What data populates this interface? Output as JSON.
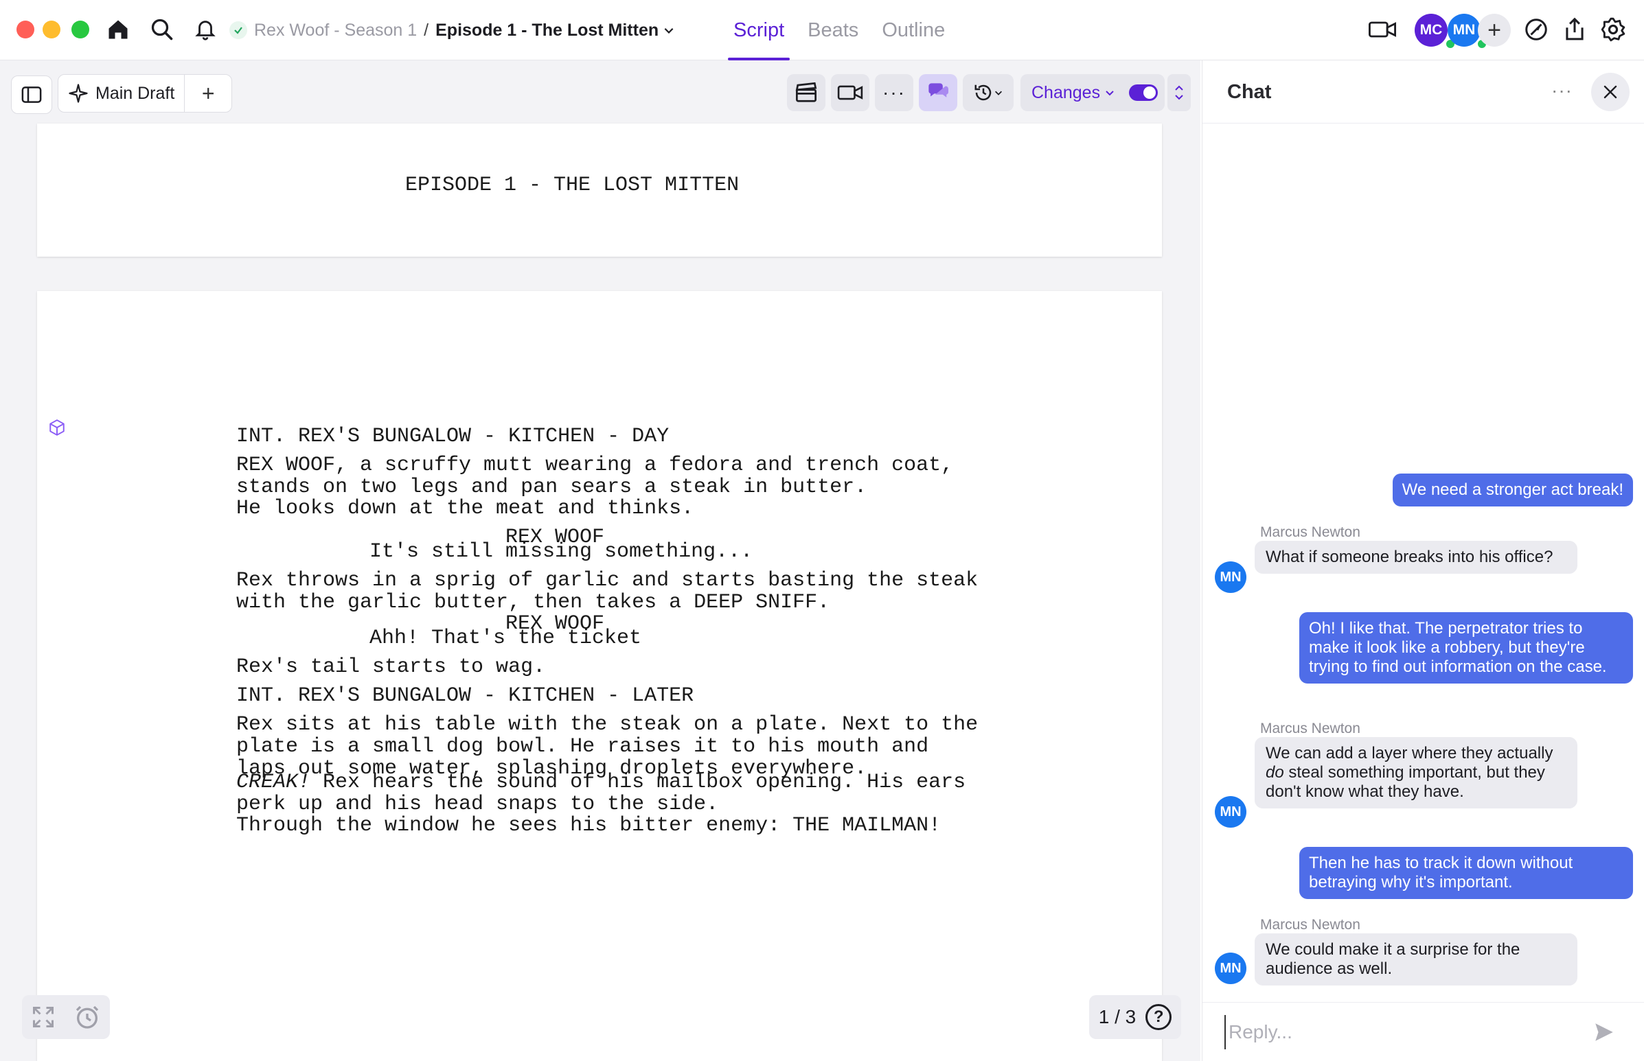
{
  "breadcrumb": {
    "season": "Rex Woof - Season 1",
    "separator": "/",
    "episode": "Episode 1 - The Lost Mitten"
  },
  "tabs": [
    "Script",
    "Beats",
    "Outline"
  ],
  "active_tab": "Script",
  "collaborators": [
    "MC",
    "MN"
  ],
  "toolbar": {
    "draft_label": "Main Draft",
    "changes_label": "Changes",
    "changes_enabled": true
  },
  "script": {
    "page_title": "EPISODE 1 - THE LOST MITTEN",
    "lines": [
      {
        "type": "scene",
        "text": "INT. REX'S BUNGALOW - KITCHEN - DAY"
      },
      {
        "type": "action",
        "text": "REX WOOF, a scruffy mutt wearing a fedora and trench coat,\nstands on two legs and pan sears a steak in butter."
      },
      {
        "type": "action",
        "text": "He looks down at the meat and thinks."
      },
      {
        "type": "character",
        "text": "REX WOOF"
      },
      {
        "type": "dialogue",
        "text": "It's still missing something..."
      },
      {
        "type": "action",
        "text": "Rex throws in a sprig of garlic and starts basting the steak\nwith the garlic butter, then takes a DEEP SNIFF."
      },
      {
        "type": "character",
        "text": "REX WOOF"
      },
      {
        "type": "dialogue",
        "text": "Ahh! That's the ticket"
      },
      {
        "type": "action",
        "text": "Rex's tail starts to wag."
      },
      {
        "type": "scene",
        "text": "INT. REX'S BUNGALOW - KITCHEN - LATER"
      },
      {
        "type": "action",
        "text": "Rex sits at his table with the steak on a plate. Next to the\nplate is a small dog bowl. He raises it to his mouth and\nlaps out some water, splashing droplets everywhere."
      },
      {
        "type": "action-italic",
        "emph": "CREAK!",
        "text": " Rex hears the sound of his mailbox opening. His ears\nperk up and his head snaps to the side."
      },
      {
        "type": "action",
        "text": "Through the window he sees his bitter enemy: THE MAILMAN!"
      }
    ]
  },
  "pager": {
    "text": "1 / 3",
    "help": "?"
  },
  "chat": {
    "title": "Chat",
    "more": "···",
    "messages": [
      {
        "from": "me",
        "text": "We need a stronger act break!"
      },
      {
        "from": "Marcus Newton",
        "initials": "MN",
        "text": "What if someone breaks into his office?"
      },
      {
        "from": "me",
        "text": "Oh! I like that. The perpetrator tries to make it look like a robbery, but they're trying to find out information on the case."
      },
      {
        "from": "Marcus Newton",
        "initials": "MN",
        "text_before": "We can add a layer where they actually ",
        "text_emph": "do",
        "text_after": " steal something important, but they don't know what they have."
      },
      {
        "from": "me",
        "text": "Then he has to track it down without betraying why it's important."
      },
      {
        "from": "Marcus Newton",
        "initials": "MN",
        "text": "We could make it a surprise for the audience as well."
      }
    ],
    "reply_placeholder": "Reply..."
  },
  "colors": {
    "accent": "#5b21d6",
    "outgoing_bubble": "#4f6de8",
    "incoming_bubble": "#ebebf0",
    "avatar_mn": "#1a78f0",
    "avatar_mc": "#5b21d6",
    "presence": "#22c55e"
  },
  "icons": [
    "home-icon",
    "search-icon",
    "bell-icon",
    "check-icon",
    "chevron-down-icon",
    "video-camera-icon",
    "compass-icon",
    "share-icon",
    "gear-icon",
    "sidebar-toggle-icon",
    "sparkle-icon",
    "plus-icon",
    "clapperboard-icon",
    "camera-icon",
    "more-icon",
    "chat-bubbles-icon",
    "history-icon",
    "chevron-up-icon",
    "cube-icon",
    "expand-icon",
    "alarm-icon",
    "help-icon",
    "close-icon",
    "send-icon"
  ]
}
